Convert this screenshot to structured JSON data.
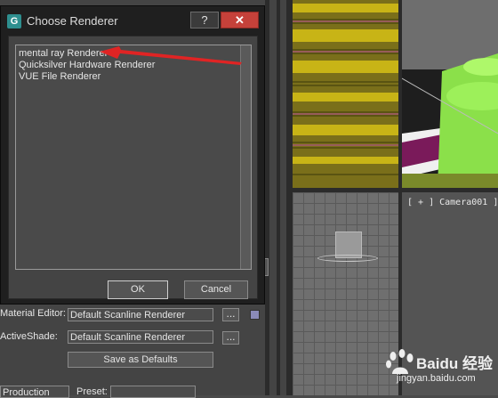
{
  "dialog": {
    "title": "Choose Renderer",
    "help_label": "?",
    "close_label": "✕",
    "renderers": [
      "mental ray Renderer",
      "Quicksilver Hardware Renderer",
      "VUE File Renderer"
    ],
    "ok_label": "OK",
    "cancel_label": "Cancel"
  },
  "assign_renderer": {
    "material_editor_label": "Material Editor:",
    "material_editor_value": "Default Scanline Renderer",
    "activeshade_label": "ActiveShade:",
    "activeshade_value": "Default Scanline Renderer",
    "browse_label": "...",
    "save_defaults_label": "Save as Defaults",
    "production_value": "Production",
    "preset_label": "Preset:"
  },
  "viewports": {
    "camera_label": "[ + ] Camera001 ]"
  },
  "watermark": {
    "brand": "Baidu 经验",
    "url": "jingyan.baidu.com"
  },
  "colors": {
    "close_red": "#c5413a",
    "annotation_red": "#e02424",
    "viewport_yellow": "#c8b416",
    "model_green": "#8be04a"
  }
}
